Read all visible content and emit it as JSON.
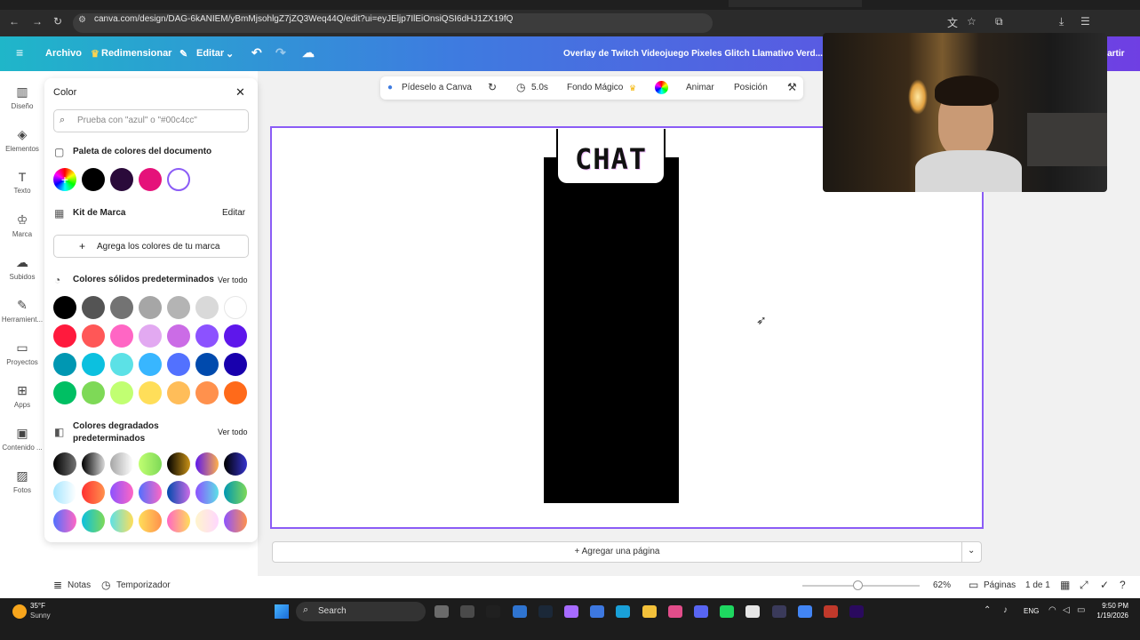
{
  "browser": {
    "url": "canva.com/design/DAG-6kANIEM/yBmMjsohlgZ7jZQ3Weq44Q/edit?ui=eyJEljp7IlEiOnsiQSI6dHJ1ZX19fQ"
  },
  "header": {
    "menu": "Archivo",
    "resize": "Redimensionar",
    "edit": "Editar",
    "design_title": "Overlay de Twitch Videojuego Pixeles Glitch Llamativo Verd...",
    "share": "partir"
  },
  "rail": [
    {
      "label": "Diseño",
      "icon": "layout-icon"
    },
    {
      "label": "Elementos",
      "icon": "shapes-icon"
    },
    {
      "label": "Texto",
      "icon": "text-icon"
    },
    {
      "label": "Marca",
      "icon": "brand-icon"
    },
    {
      "label": "Subidos",
      "icon": "cloud-upload-icon"
    },
    {
      "label": "Herramient...",
      "icon": "pen-icon"
    },
    {
      "label": "Proyectos",
      "icon": "folder-icon"
    },
    {
      "label": "Apps",
      "icon": "apps-icon"
    },
    {
      "label": "Contenido ...",
      "icon": "content-icon"
    },
    {
      "label": "Fotos",
      "icon": "photo-icon"
    }
  ],
  "panel": {
    "title": "Color",
    "search_placeholder": "Prueba con \"azul\" o \"#00c4cc\"",
    "doc_palette_title": "Paleta de colores del documento",
    "doc_colors": [
      "#000000",
      "#2a0a3a",
      "#e5127a",
      "#ffffff"
    ],
    "brand_kit_title": "Kit de Marca",
    "brand_kit_edit": "Editar",
    "add_brand_colors": "Agrega los colores de tu marca",
    "solid_title": "Colores sólidos predeterminados",
    "solid_see_all": "Ver todo",
    "solid_colors": [
      "#000000",
      "#545454",
      "#737373",
      "#a6a6a6",
      "#b4b4b4",
      "#d9d9d9",
      "#ffffff",
      "#ff1a3d",
      "#ff5757",
      "#ff66c4",
      "#e2a9f1",
      "#cb6ce6",
      "#8c52ff",
      "#5e17eb",
      "#0097b2",
      "#0cc0df",
      "#5ce1e6",
      "#38b6ff",
      "#5271ff",
      "#004aad",
      "#1800ad",
      "#00bf63",
      "#7ed957",
      "#c1ff72",
      "#ffde59",
      "#ffbd59",
      "#ff914d",
      "#ff6a1a"
    ],
    "gradient_title": "Colores degradados predeterminados",
    "gradient_see_all": "Ver todo",
    "gradients": [
      [
        "#000000",
        "#737373"
      ],
      [
        "#000000",
        "#d9d9d9"
      ],
      [
        "#a6a6a6",
        "#ffffff"
      ],
      [
        "#c1ff72",
        "#7ed957"
      ],
      [
        "#000000",
        "#c89116"
      ],
      [
        "#5e17eb",
        "#ffb14a"
      ],
      [
        "#000000",
        "#3533cd"
      ],
      [
        "#a6e6ff",
        "#ffffff"
      ],
      [
        "#ff3131",
        "#ff914d"
      ],
      [
        "#8c52ff",
        "#ff66c4"
      ],
      [
        "#5170ff",
        "#ff66c4"
      ],
      [
        "#004aad",
        "#cb6ce6"
      ],
      [
        "#8c52ff",
        "#5ce1e6"
      ],
      [
        "#0097b2",
        "#7ed957"
      ],
      [
        "#5170ff",
        "#ff66c4"
      ],
      [
        "#0cc0df",
        "#7ed957"
      ],
      [
        "#5ce1e6",
        "#ffde59"
      ],
      [
        "#ffde59",
        "#ff914d"
      ],
      [
        "#ff66c4",
        "#ffde59"
      ],
      [
        "#fff5cc",
        "#ffd7ff"
      ],
      [
        "#8c52ff",
        "#ff914d"
      ]
    ]
  },
  "context_bar": {
    "ask": "Pídeselo a Canva",
    "duration": "5.0s",
    "magic_bg": "Fondo Mágico",
    "animate": "Animar",
    "position": "Posición"
  },
  "canvas": {
    "chat_text": "CHAT",
    "add_page": "+ Agregar una página"
  },
  "footer": {
    "notes": "Notas",
    "timer": "Temporizador",
    "zoom": "62%",
    "pages_label": "Páginas",
    "pages_count": "1 de 1"
  },
  "taskbar": {
    "temp": "35°F",
    "weather": "Sunny",
    "search": "Search",
    "lang": "ENG",
    "time": "9:50 PM",
    "date": "1/19/2026"
  }
}
